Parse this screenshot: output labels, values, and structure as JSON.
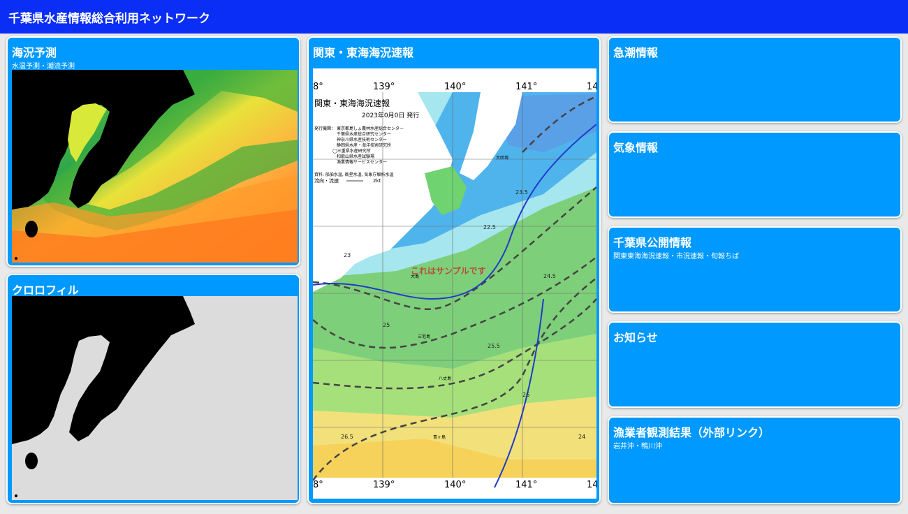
{
  "header": {
    "title": "千葉県水産情報総合利用ネットワーク"
  },
  "left": {
    "forecast": {
      "title": "海況予測",
      "subtitle": "水温予測・潮流予測"
    },
    "chlorophyll": {
      "title": "クロロフィル"
    }
  },
  "center": {
    "title": "関東・東海海況速報",
    "map": {
      "heading": "関東・東海海況速報",
      "date": "2023年0月0日 発行",
      "issuer_label": "発行機関：",
      "issuers": [
        "東京都島しょ農林水産総合センター",
        "千葉県水産総合研究センター",
        "神奈川県水産技術センター",
        "静岡県水産・海洋技術研究所",
        "◯三重県水産研究所",
        "和歌山県水産試験場",
        "漁業情報サービスセンター"
      ],
      "source": "資料: 船舶水温, 衛星水温, 気象庁解析水温",
      "flow_label": "流向・流速",
      "flow_value": "2kt",
      "watermark": "これはサンプルです",
      "lon_top": [
        "8°",
        "139°",
        "140°",
        "141°",
        "14"
      ],
      "lon_bottom": [
        "8°",
        "139°",
        "140°",
        "141°",
        "14"
      ],
      "isotherms": [
        "22.5",
        "23",
        "23.5",
        "24",
        "24.5",
        "25",
        "25.5",
        "26",
        "26.5"
      ],
      "places": [
        "大吠埼",
        "八丈島",
        "大島",
        "三宅島",
        "青ヶ島"
      ]
    }
  },
  "right": {
    "items": [
      {
        "title": "急潮情報",
        "subtitle": ""
      },
      {
        "title": "気象情報",
        "subtitle": ""
      },
      {
        "title": "千葉県公開情報",
        "subtitle": "関東東海海況速報・市況速報・旬報ちば"
      },
      {
        "title": "お知らせ",
        "subtitle": ""
      },
      {
        "title": "漁業者観測結果（外部リンク）",
        "subtitle": "岩井沖・鴨川沖"
      }
    ]
  },
  "colors": {
    "header_bg": "#0a2ef5",
    "card_bg": "#0099ff",
    "land": "#000000",
    "chlorophyll_sea": "#dcdcdc"
  }
}
